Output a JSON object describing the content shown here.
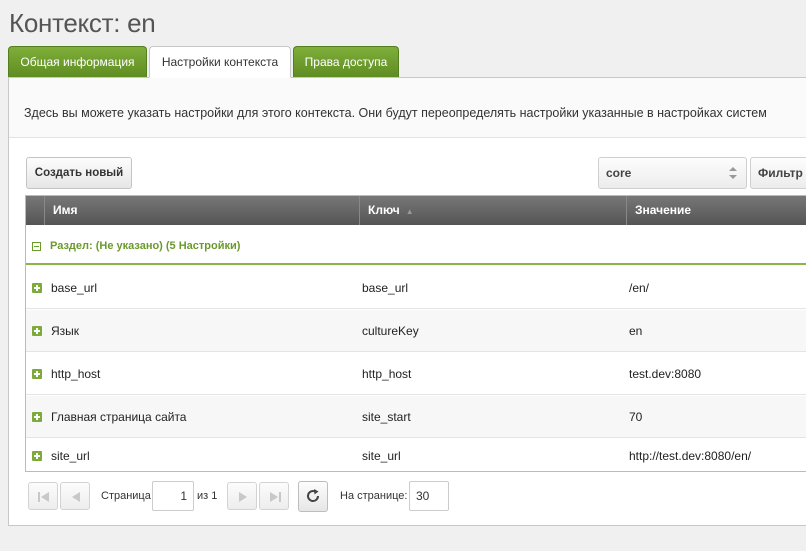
{
  "page": {
    "title": "Контекст: en"
  },
  "tabs": [
    {
      "label": "Общая информация",
      "active": false
    },
    {
      "label": "Настройки контекста",
      "active": true
    },
    {
      "label": "Права доступа",
      "active": false
    }
  ],
  "description": "Здесь вы можете указать настройки для этого контекста. Они будут переопределять настройки указанные в настройках систем",
  "toolbar": {
    "create_label": "Создать новый",
    "namespace_value": "core",
    "filter_label": "Фильтр по"
  },
  "grid": {
    "columns": [
      "Имя",
      "Ключ",
      "Значение"
    ],
    "group_label": "Раздел: (Не указано) (5 Настройки)",
    "rows": [
      {
        "name": "base_url",
        "key": "base_url",
        "value": "/en/"
      },
      {
        "name": "Язык",
        "key": "cultureKey",
        "value": "en"
      },
      {
        "name": "http_host",
        "key": "http_host",
        "value": "test.dev:8080"
      },
      {
        "name": "Главная страница сайта",
        "key": "site_start",
        "value": "70"
      },
      {
        "name": "site_url",
        "key": "site_url",
        "value": "http://test.dev:8080/en/"
      }
    ]
  },
  "pager": {
    "page_label": "Страница",
    "page_value": "1",
    "of_label": "из 1",
    "per_page_label": "На странице:",
    "per_page_value": "30"
  },
  "colors": {
    "accent_green": "#6b9a2c",
    "header_dark": "#666666"
  }
}
